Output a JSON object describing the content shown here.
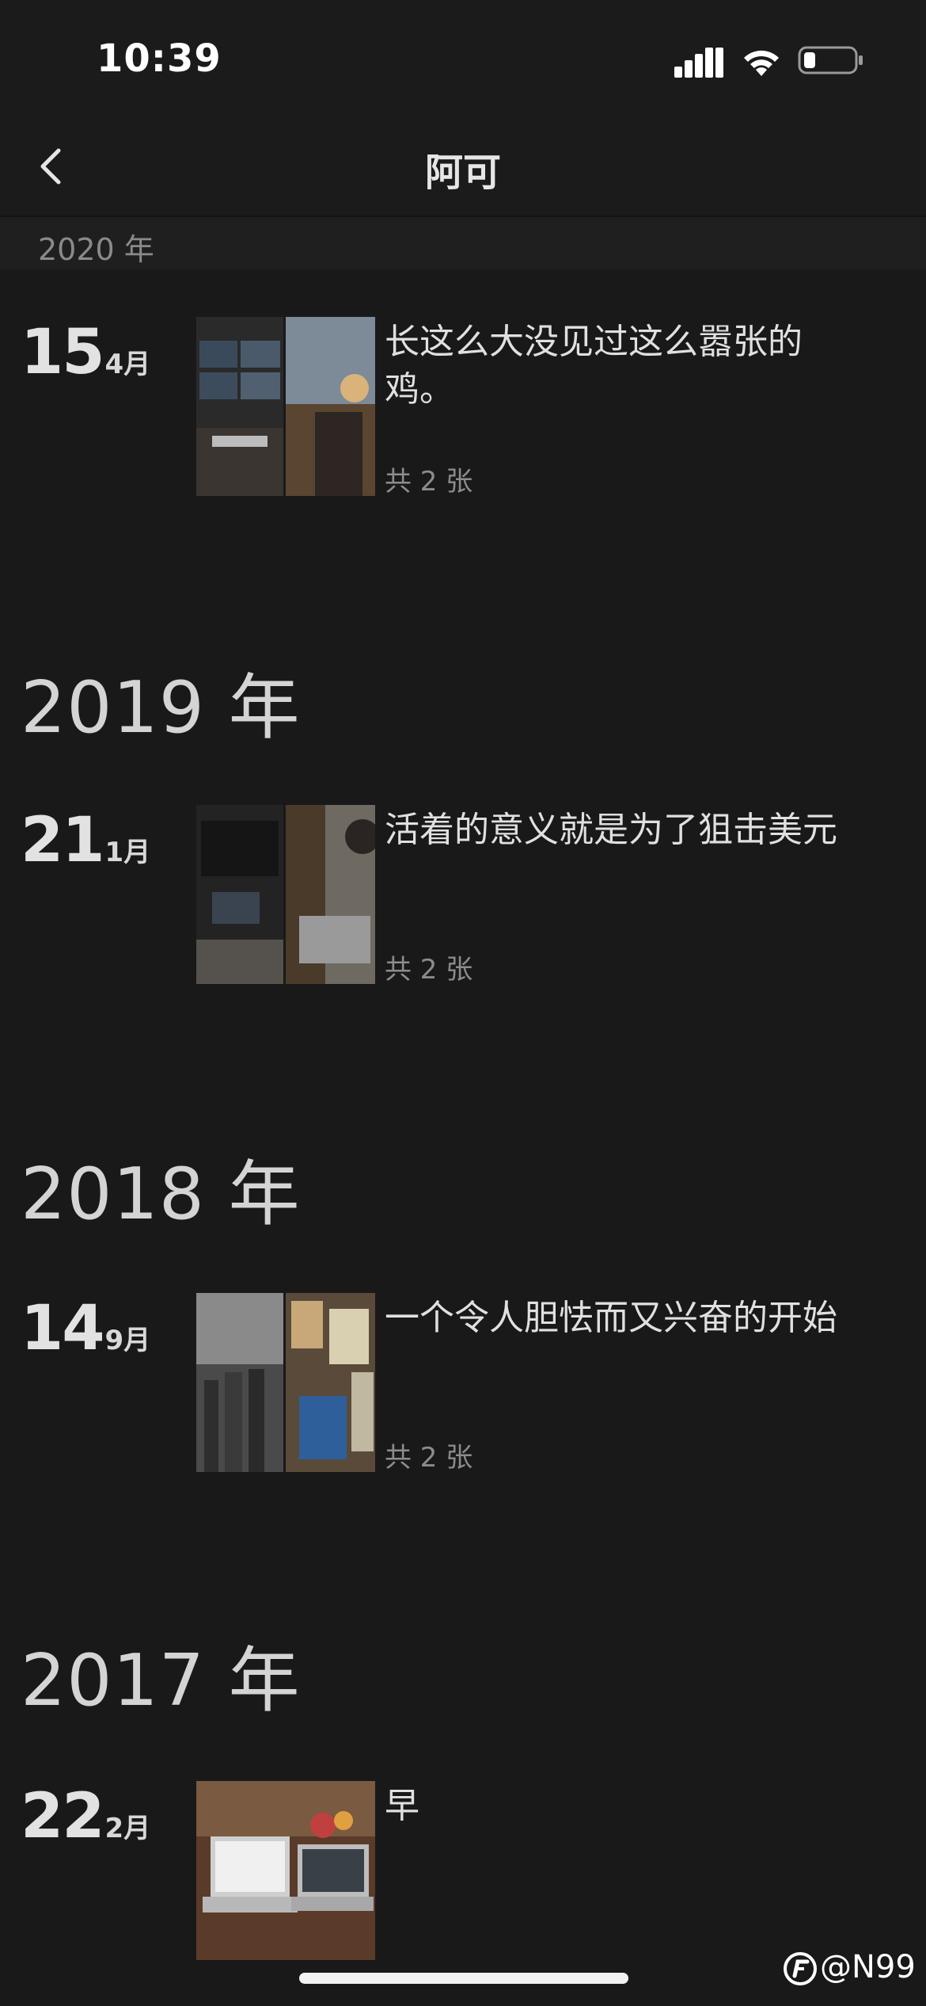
{
  "status_bar": {
    "time": "10:39",
    "icons": [
      "cellular-signal-icon",
      "wifi-icon",
      "battery-low-icon"
    ]
  },
  "nav": {
    "back_icon": "chevron-left-icon",
    "title": "阿可"
  },
  "sticky_year": "2020 年",
  "years": [
    {
      "label": "2019 年",
      "entries": []
    },
    {
      "label": "2018 年",
      "entries": []
    },
    {
      "label": "2017 年",
      "entries": []
    }
  ],
  "entries": [
    {
      "day": "15",
      "month": "4月",
      "text": "长这么大没见过这么嚣张的鸡。",
      "count": "共 2 张"
    },
    {
      "day": "21",
      "month": "1月",
      "text": "活着的意义就是为了狙击美元",
      "count": "共 2 张"
    },
    {
      "day": "14",
      "month": "9月",
      "text": "一个令人胆怯而又兴奋的开始",
      "count": "共 2 张"
    },
    {
      "day": "22",
      "month": "2月",
      "text": "早",
      "count": ""
    }
  ],
  "watermark": "@N99",
  "colors": {
    "background": "#191919",
    "bar": "#1b1b1b",
    "text_primary": "#e0e0e0",
    "text_secondary": "#8c8c8c"
  }
}
